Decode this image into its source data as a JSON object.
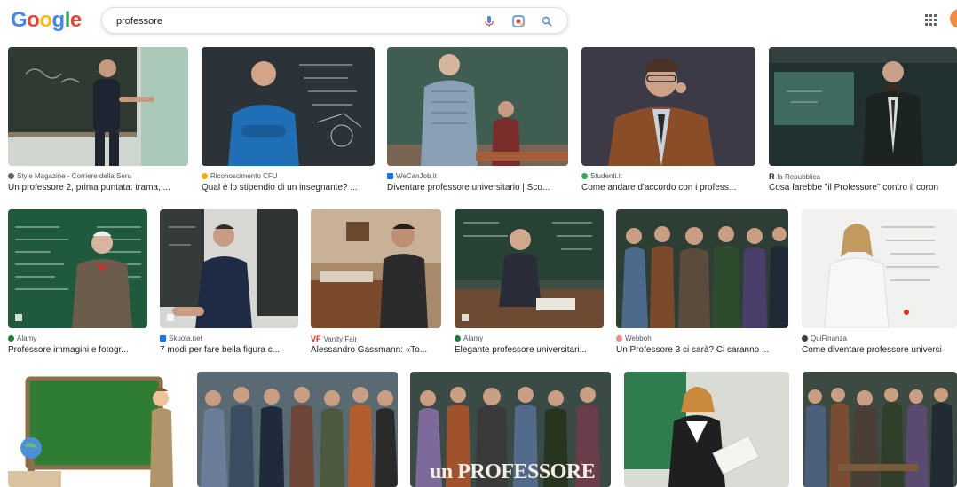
{
  "header": {
    "logo": [
      "G",
      "o",
      "o",
      "g",
      "l",
      "e"
    ],
    "logo_colors": [
      "#4285f4",
      "#ea4335",
      "#fbbc05",
      "#4285f4",
      "#34a853",
      "#ea4335"
    ],
    "search_value": "professore"
  },
  "results": [
    {
      "source": "Style Magazine - Corriere della Sera",
      "title": "Un professore 2, prima puntata: trama, ...",
      "fav": "#5f6368"
    },
    {
      "source": "Riconoscimento CFU",
      "title": "Qual è lo stipendio di un insegnante? ...",
      "fav": "#f9ab00"
    },
    {
      "source": "WeCanJob.it",
      "title": "Diventare professore universitario | Sco...",
      "fav": "#1a73e8"
    },
    {
      "source": "Studenti.it",
      "title": "Come andare d'accordo con i profess...",
      "fav": "#34a853"
    },
    {
      "source": "la Repubblica",
      "title": "Cosa farebbe \"il Professore\" contro il coron",
      "fav": "#202124"
    },
    {
      "source": "Alamy",
      "title": "Professore immagini e fotogr...",
      "fav": "#188038"
    },
    {
      "source": "Skuola.net",
      "title": "7 modi per fare bella figura c...",
      "fav": "#1a73e8"
    },
    {
      "source": "Vanity Fair",
      "title": "Alessandro Gassmann: «To...",
      "fav": "#d93025"
    },
    {
      "source": "Alamy",
      "title": "Elegante professore universitari...",
      "fav": "#188038"
    },
    {
      "source": "Webboh",
      "title": "Un Professore 3 ci sarà? Ci saranno ...",
      "fav": "#f28b82"
    },
    {
      "source": "QuiFinanza",
      "title": "Come diventare professore universi",
      "fav": "#3c4043"
    }
  ],
  "overlay_text": "un PROFESSORE"
}
